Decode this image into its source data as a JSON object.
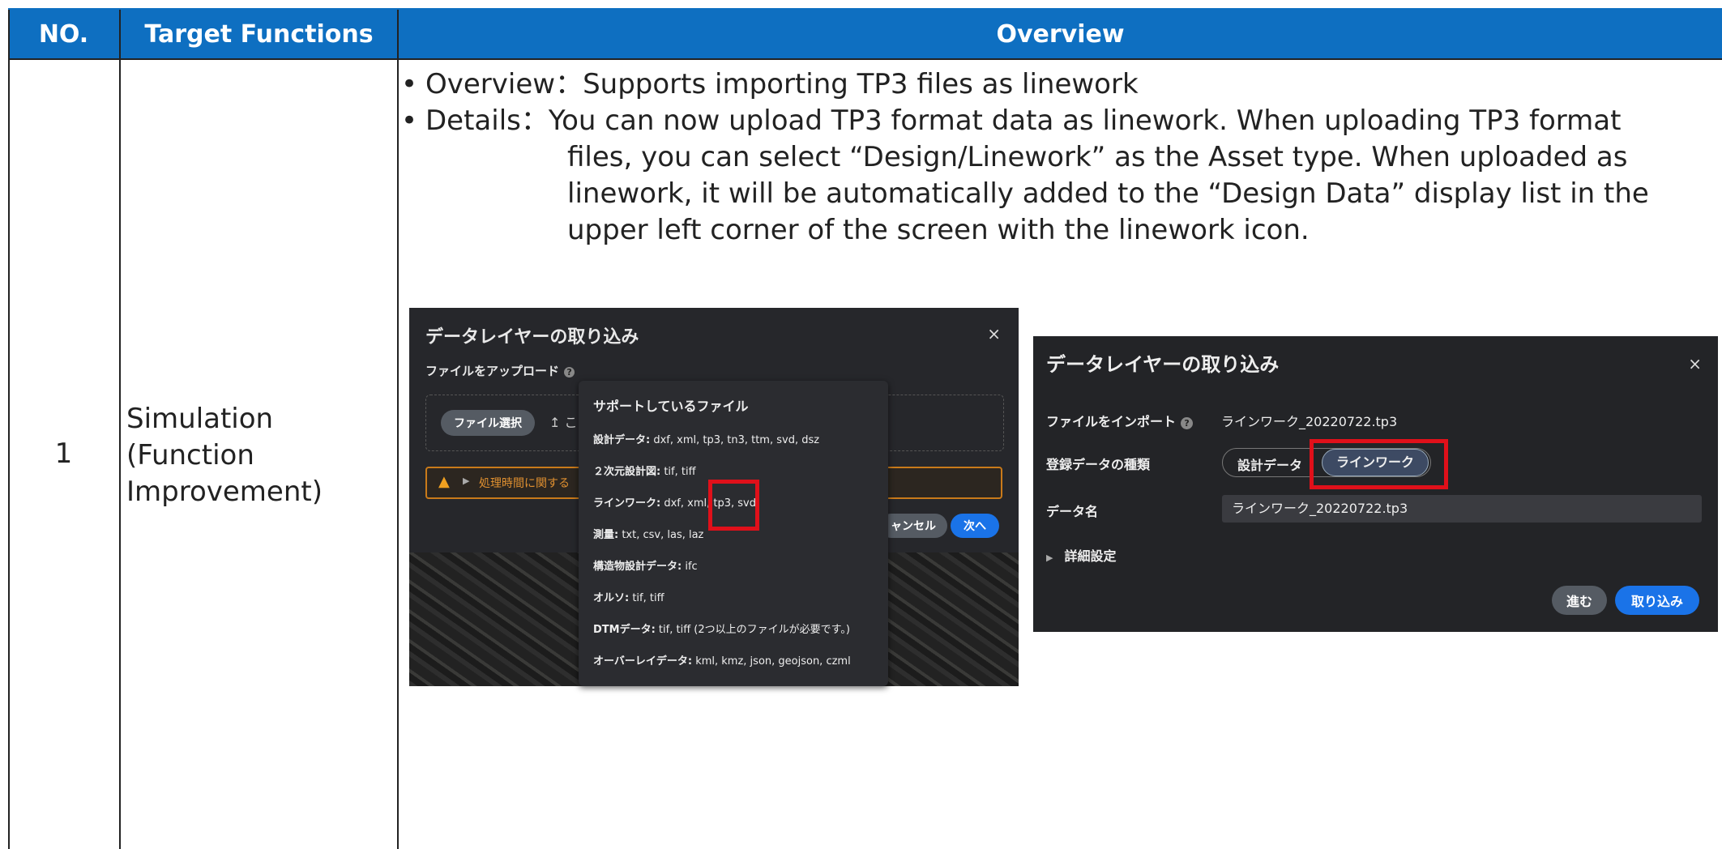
{
  "header": {
    "no": "NO.",
    "functions": "Target Functions",
    "overview": "Overview"
  },
  "row": {
    "no": "1",
    "function_lines": [
      "Simulation",
      "(Function",
      "Improvement)"
    ],
    "bullet_overview_key": "Overview：",
    "bullet_overview_val": "Supports importing TP3 files as linework",
    "bullet_details_key": "Details：",
    "bullet_details_line1": "You can now upload TP3 format data as linework. When uploading TP3 format",
    "bullet_details_line2": "files, you can select “Design/Linework” as the Asset type. When uploaded as",
    "bullet_details_line3": "linework, it will be automatically added to the “Design Data” display list in the",
    "bullet_details_line4": "upper left corner of the screen with the linework icon."
  },
  "dialog1": {
    "title": "データレイヤーの取り込み",
    "close": "×",
    "upload_label": "ファイルをアップロード",
    "help": "?",
    "file_button": "ファイル選択",
    "upload_icon": "↥",
    "upload_partial": "こ",
    "warning_text": "処理時間に関する",
    "cancel": "ャンセル",
    "next": "次へ"
  },
  "tooltip": {
    "title": "サポートしているファイル",
    "items": [
      {
        "k": "設計データ:",
        "v": " dxf, xml, tp3, tn3, ttm, svd, dsz"
      },
      {
        "k": "２次元設計図:",
        "v": " tif, tiff"
      },
      {
        "k": "ラインワーク:",
        "v": " dxf, xml, tp3, svd"
      },
      {
        "k": "測量:",
        "v": " txt, csv, las, laz"
      },
      {
        "k": "構造物設計データ:",
        "v": " ifc"
      },
      {
        "k": "オルソ:",
        "v": " tif, tiff"
      },
      {
        "k": "DTMデータ:",
        "v": " tif, tiff (2つ以上のファイルが必要です。)"
      },
      {
        "k": "オーバーレイデータ:",
        "v": " kml, kmz, json, geojson, czml"
      }
    ]
  },
  "dialog2": {
    "title": "データレイヤーの取り込み",
    "close": "×",
    "import_label": "ファイルをインポート",
    "help": "?",
    "import_file": "ラインワーク_20220722.tp3",
    "type_label": "登録データの種類",
    "type_option1": "設計データ",
    "type_option2": "ラインワーク",
    "name_label": "データ名",
    "name_value": "ラインワーク_20220722.tp3",
    "advanced": "詳細設定",
    "back": "進む",
    "import": "取り込み"
  },
  "colors": {
    "header_bg": "#0e6fc1",
    "highlight": "#e0101a",
    "primary_button": "#1a73e8"
  }
}
